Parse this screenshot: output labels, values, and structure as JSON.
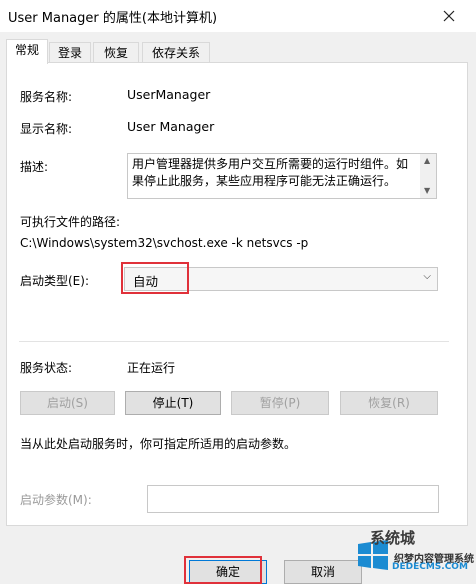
{
  "window": {
    "title": "User Manager 的属性(本地计算机)"
  },
  "tabs": [
    {
      "label": "常规",
      "active": true
    },
    {
      "label": "登录",
      "active": false
    },
    {
      "label": "恢复",
      "active": false
    },
    {
      "label": "依存关系",
      "active": false
    }
  ],
  "general": {
    "service_name_label": "服务名称:",
    "service_name_value": "UserManager",
    "display_name_label": "显示名称:",
    "display_name_value": "User Manager",
    "description_label": "描述:",
    "description_value": "用户管理器提供多用户交互所需要的运行时组件。如果停止此服务，某些应用程序可能无法正确运行。",
    "exe_path_label": "可执行文件的路径:",
    "exe_path_value": "C:\\Windows\\system32\\svchost.exe -k netsvcs -p",
    "startup_type_label": "启动类型(E):",
    "startup_type_value": "自动",
    "status_label": "服务状态:",
    "status_value": "正在运行",
    "buttons": {
      "start": "启动(S)",
      "stop": "停止(T)",
      "pause": "暂停(P)",
      "resume": "恢复(R)"
    },
    "hint_text": "当从此处启动服务时，你可指定所适用的启动参数。",
    "start_params_label": "启动参数(M):",
    "start_params_value": ""
  },
  "footer": {
    "ok_label": "确定",
    "cancel_label": "取消"
  },
  "watermark": {
    "line1": "系统城",
    "line2": "织梦内容管理系统",
    "line3": "DEDECMS.COM"
  },
  "colors": {
    "highlight": "#e0313a",
    "primary_border": "#0078d7"
  }
}
